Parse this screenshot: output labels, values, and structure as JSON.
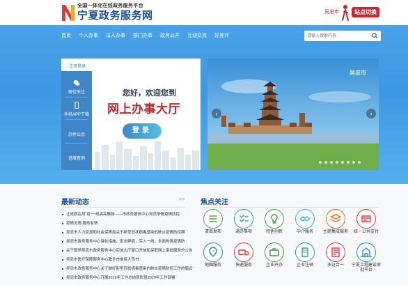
{
  "header": {
    "logo_small": "全国一体化在线政务服务平台",
    "logo_big": "宁夏政务服务网",
    "city": "吴忠市",
    "switch_label": "站点切换"
  },
  "nav": {
    "items": [
      "首页",
      "个人办事",
      "法人办事",
      "部门办事",
      "政务公开",
      "互动交流",
      "好差评"
    ],
    "search_placeholder": "请输入搜索内容"
  },
  "panel": {
    "tab": "注册登录",
    "side_items": [
      "微信关注",
      "手机APP下载",
      "办件公示",
      "进度查询"
    ],
    "welcome": "您好，欢迎您到",
    "hall": "网上办事大厅",
    "login": "登录"
  },
  "banner": {
    "city_text": "吴忠市"
  },
  "news": {
    "title": "最新动态",
    "more": ">>",
    "items": [
      "让党旗在战“疫”一线高高飘扬——市政务服务中心党员争做疫情防控",
      "疫情无情 服务有情",
      "吴忠市人力资源和社会保障局关于新型冠状病毒感染的肺炎疫情防控期",
      "吴忠市政务服务中心强化措施，走出弊病，深入一线，全面构筑疫情防",
      "关于暂停吴忠市政务服务中心实体大厅窗口开放和采取网上审批服务的公告",
      "吴忠市医疗保障服务中心致全市参保人员书",
      "吴忠市政务服务中心关于做好新型冠状病毒感染的肺炎疫情防控工作的倡议书",
      "吴忠市政务服务中心开展2019年工作总结表彰暨2020年工作部署"
    ]
  },
  "focus": {
    "title": "焦点关注",
    "items": [
      {
        "label": "清单发布",
        "color": "#4caf50",
        "icon": "list-icon"
      },
      {
        "label": "通办事项",
        "color": "#26a69a",
        "icon": "checklist-icon"
      },
      {
        "label": "特色创新",
        "color": "#43a047",
        "icon": "lightbulb-icon"
      },
      {
        "label": "中介服务",
        "color": "#29b6f6",
        "icon": "handshake-icon"
      },
      {
        "label": "主题集成服务",
        "color": "#ef6c00",
        "icon": "layers-icon"
      },
      {
        "label": "统一公共支付",
        "color": "#e53935",
        "icon": "payment-icon"
      },
      {
        "label": "地图服务",
        "color": "#1e88e5",
        "icon": "map-pin-icon"
      },
      {
        "label": "快递服务",
        "color": "#e53935",
        "icon": "delivery-icon"
      },
      {
        "label": "企业开办",
        "color": "#43a047",
        "icon": "briefcase-icon"
      },
      {
        "label": "企业注销",
        "color": "#26a69a",
        "icon": "building-icon"
      },
      {
        "label": "多证合一",
        "color": "#e53935",
        "icon": "certificate-icon"
      },
      {
        "label": "宁夏工程建设审批平台",
        "color": "#1e88e5",
        "icon": "construction-icon"
      }
    ]
  },
  "colors": {
    "nav_blue": "#3e98e2",
    "brand_red": "#c8282d",
    "brand_blue": "#1a4f9c",
    "panel_blue": "#3f86c8"
  }
}
